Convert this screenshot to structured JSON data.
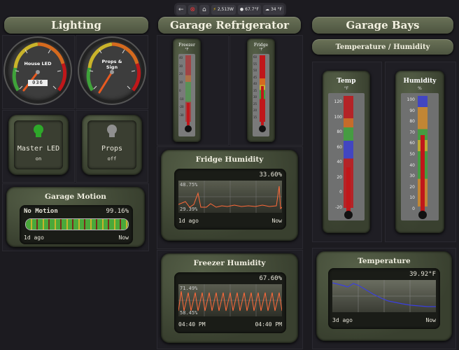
{
  "topbar": {
    "power": "2,513W",
    "outdoor_temp": "67.7°F",
    "cloud_temp": "34 °F"
  },
  "colors": {
    "red": "#c0171a",
    "orange": "#d56a1e",
    "yellow": "#c9b32a",
    "green": "#3fa33a",
    "blue": "#3a3fcf",
    "trace": "#ff6a3a"
  },
  "lighting": {
    "header": "Lighting",
    "gauge1": {
      "label": "House LED",
      "value": 36,
      "odometer": "036"
    },
    "gauge2": {
      "label_line1": "Props &",
      "label_line2": "Sign",
      "value": 53
    },
    "gauge_ticks": [
      "0",
      "50",
      "100",
      "150",
      "200",
      "250"
    ],
    "master": {
      "label": "Master LED",
      "state": "on"
    },
    "props": {
      "label": "Props",
      "state": "off"
    },
    "motion": {
      "title": "Garage Motion",
      "status": "No Motion",
      "percent": "99.16%",
      "start": "1d ago",
      "end": "Now"
    }
  },
  "fridge": {
    "header": "Garage Refrigerator",
    "freezer_therm": {
      "label": "Freezer",
      "unit": "°F",
      "ticks": [
        "40",
        "30",
        "20",
        "10",
        "0",
        "-10",
        "-20",
        "-30"
      ],
      "level": 0.25
    },
    "fridge_therm": {
      "label": "Fridge",
      "unit": "°F",
      "ticks": [
        "60",
        "55",
        "50",
        "45",
        "40",
        "35",
        "30",
        "25",
        "20",
        "15"
      ],
      "level": 0.53
    },
    "fridge_humidity": {
      "title": "Fridge Humidity",
      "current": "33.60%",
      "max": "48.75%",
      "min": "29.39%",
      "start": "1d ago",
      "end": "Now"
    },
    "freezer_humidity": {
      "title": "Freezer Humidity",
      "current": "67.60%",
      "max": "71.49%",
      "min": "58.45%",
      "start": "04:40 PM",
      "end": "04:40 PM"
    }
  },
  "bays": {
    "header": "Garage Bays",
    "subheader": "Temperature / Humidity",
    "temp": {
      "label": "Temp",
      "unit": "°F",
      "ticks": [
        "120",
        "100",
        "80",
        "60",
        "40",
        "20",
        "0",
        "-20"
      ],
      "level": 0.42
    },
    "humidity": {
      "label": "Humidity",
      "unit": "%",
      "ticks": [
        "100",
        "90",
        "80",
        "70",
        "60",
        "50",
        "40",
        "30",
        "20",
        "10",
        "0"
      ],
      "level": 0.68
    },
    "temperature": {
      "title": "Temperature",
      "current": "39.92°F",
      "start": "3d ago",
      "end": "Now"
    }
  }
}
